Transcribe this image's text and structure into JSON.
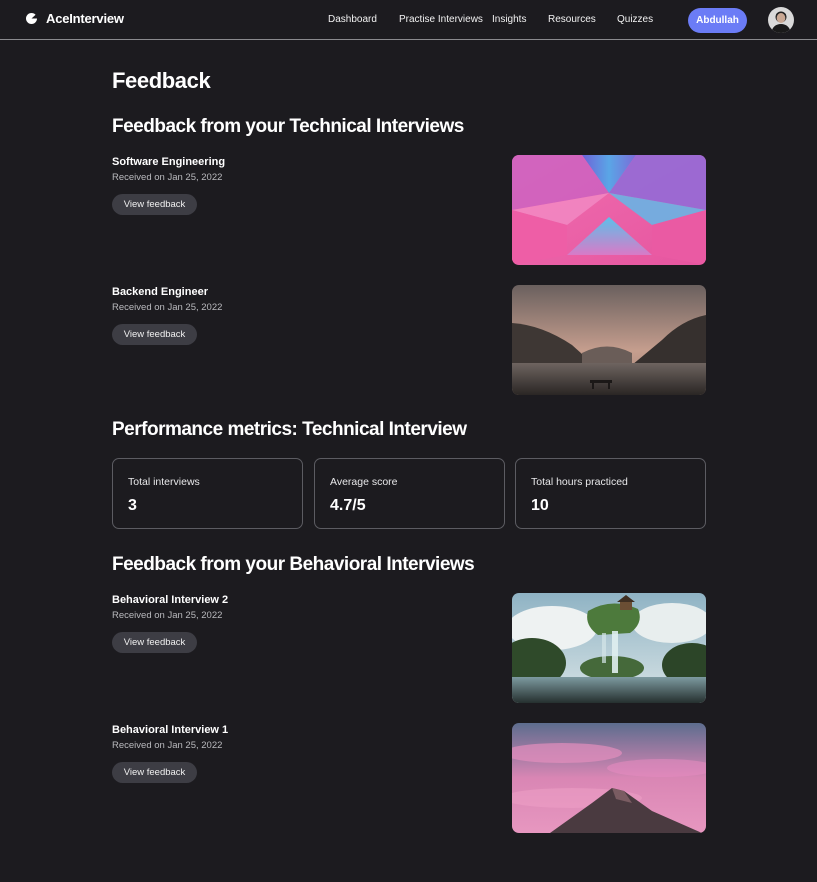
{
  "app": {
    "name": "AceInterview"
  },
  "nav": {
    "links": [
      "Dashboard",
      "Practise Interviews",
      "Insights",
      "Resources",
      "Quizzes"
    ],
    "user_button": "Abdullah"
  },
  "page": {
    "title": "Feedback"
  },
  "technical": {
    "title": "Feedback from your Technical Interviews",
    "items": [
      {
        "title": "Software  Engineering",
        "date": "Received on Jan 25, 2022",
        "button": "View feedback",
        "image": "pink-blue-geometric-image"
      },
      {
        "title": "Backend Engineer",
        "date": "Received on Jan 25, 2022",
        "button": "View feedback",
        "image": "mountain-lake-image"
      }
    ]
  },
  "metrics": {
    "title": "Performance metrics: Technical Interview",
    "cards": [
      {
        "label": "Total interviews",
        "value": "3"
      },
      {
        "label": "Average score",
        "value": "4.7/5"
      },
      {
        "label": "Total hours practiced",
        "value": "10"
      }
    ]
  },
  "behavioral": {
    "title": "Feedback from your Behavioral Interviews",
    "items": [
      {
        "title": "Behavioral Interview  2",
        "date": "Received on Jan 25, 2022",
        "button": "View feedback",
        "image": "floating-island-waterfall-image"
      },
      {
        "title": "Behavioral Interview  1",
        "date": "Received on Jan 25, 2022",
        "button": "View feedback",
        "image": "pink-sky-mountain-image"
      }
    ]
  },
  "colors": {
    "background": "#1c1b1f",
    "accent": "#6b7cf6",
    "button_bg": "#3d3d44",
    "card_border": "#5c5c62"
  }
}
